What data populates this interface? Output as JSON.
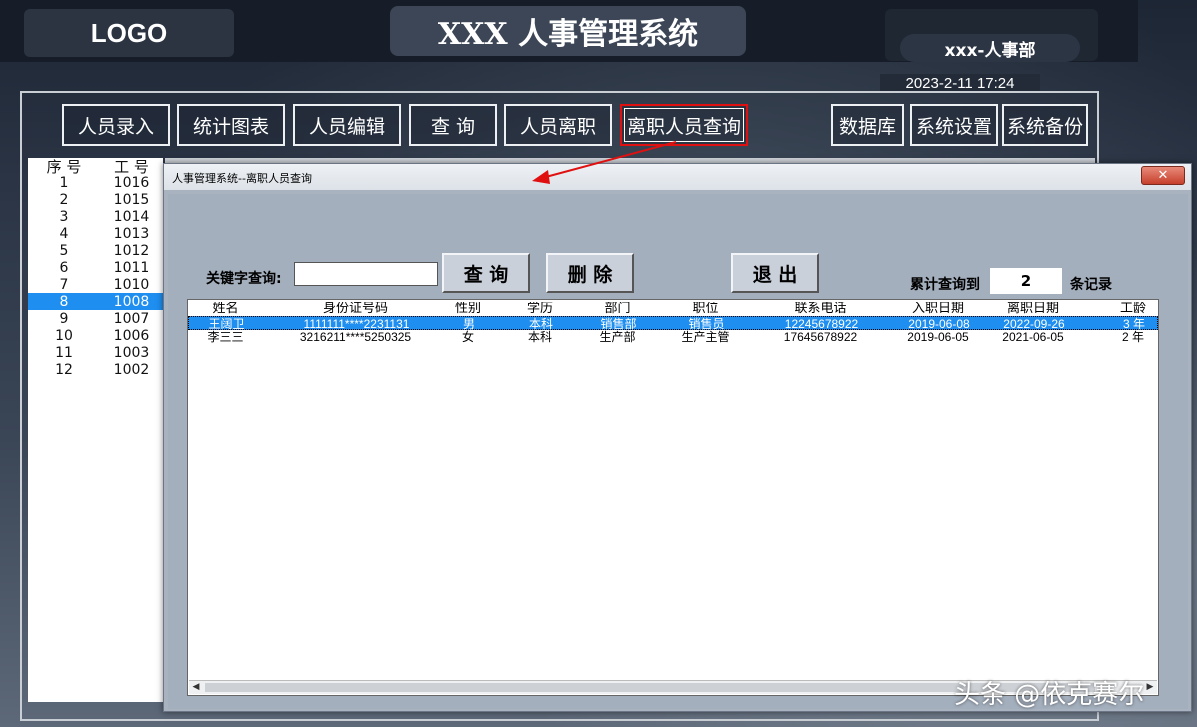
{
  "header": {
    "logo": "LOGO",
    "title": "XXX 人事管理系统",
    "department": "xxx-人事部",
    "datetime": "2023-2-11 17:24"
  },
  "nav": {
    "left": [
      "人员录入",
      "统计图表",
      "人员编辑",
      "查 询",
      "人员离职",
      "离职人员查询"
    ],
    "right": [
      "数据库",
      "系统设置",
      "系统备份"
    ],
    "active": "离职人员查询"
  },
  "side_list": {
    "headers": [
      "序 号",
      "工 号"
    ],
    "rows": [
      [
        "1",
        "1016"
      ],
      [
        "2",
        "1015"
      ],
      [
        "3",
        "1014"
      ],
      [
        "4",
        "1013"
      ],
      [
        "5",
        "1012"
      ],
      [
        "6",
        "1011"
      ],
      [
        "7",
        "1010"
      ],
      [
        "8",
        "1008"
      ],
      [
        "9",
        "1007"
      ],
      [
        "10",
        "1006"
      ],
      [
        "11",
        "1003"
      ],
      [
        "12",
        "1002"
      ]
    ],
    "selected_index": 7
  },
  "dialog": {
    "title": "人事管理系统--离职人员查询",
    "close_label": "✕",
    "search_label": "关键字查询:",
    "search_value": "",
    "btn_query": "查 询",
    "btn_delete": "删 除",
    "btn_exit": "退 出",
    "count_label": "累计查询到",
    "count_value": "2",
    "count_suffix": "条记录",
    "columns": [
      "姓名",
      "身份证号码",
      "性别",
      "学历",
      "部门",
      "职位",
      "联系电话",
      "入职日期",
      "离职日期",
      "工龄"
    ],
    "rows": [
      [
        "王阔卫",
        "1111111****2231131",
        "男",
        "本科",
        "销售部",
        "销售员",
        "12245678922",
        "2019-06-08",
        "2022-09-26",
        "3 年"
      ],
      [
        "李三三",
        "3216211****5250325",
        "女",
        "本科",
        "生产部",
        "生产主管",
        "17645678922",
        "2019-06-05",
        "2021-06-05",
        "2 年"
      ]
    ]
  },
  "watermark": "头条 @依克赛尔",
  "colors": {
    "selection": "#1e8ef0",
    "highlight_border": "#e01010",
    "arrow": "#e01010"
  }
}
